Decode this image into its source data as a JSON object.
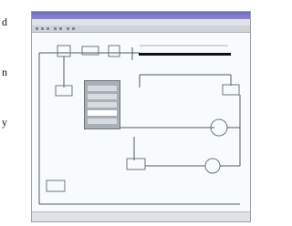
{
  "side_text": [
    "d",
    "n",
    "y"
  ],
  "window": {
    "title": "",
    "menu": "",
    "status": [
      "",
      "",
      ""
    ]
  },
  "diagram": {
    "node_labels": [
      "",
      "",
      "",
      "",
      "",
      "",
      ""
    ]
  },
  "colors": {
    "title_bar": "#7b77c6",
    "wire": "#4e5966",
    "bus": "#111111",
    "panel": "#a9afb6"
  }
}
